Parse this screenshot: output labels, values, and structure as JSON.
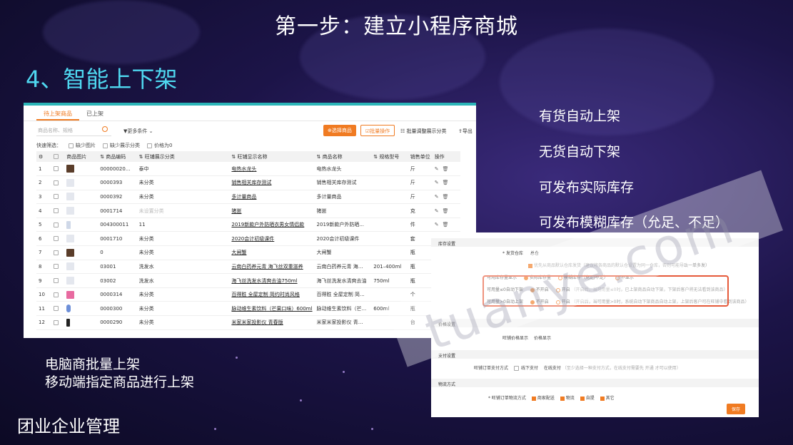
{
  "slide": {
    "title": "第一步：建立小程序商城",
    "section": "4、智能上下架",
    "features": [
      "有货自动上架",
      "无货自动下架",
      "可发布实际库存",
      "可发布模糊库存（允足、不足）"
    ],
    "notes": [
      "电脑商批量上架",
      "移动端指定商品进行上架"
    ],
    "company": "团业企业管理",
    "watermark": "tuanye.com"
  },
  "product_panel": {
    "tabs": [
      "待上架商品",
      "已上架"
    ],
    "search_placeholder": "商品名称、规格",
    "more_filter": "更多条件",
    "select_btn": "选择商品",
    "batch_btn": "批量操作",
    "batch_category": "批量调整展示分类",
    "export": "导出",
    "quick_filter_label": "快速筛选：",
    "quick_filters": [
      "缺少图片",
      "缺少展示分类",
      "价格为0"
    ],
    "columns": [
      "商品图片",
      "商品编码",
      "旺铺展示分类",
      "旺铺显示名称",
      "商品名称",
      "规格型号",
      "销售单位",
      "操作"
    ],
    "rows": [
      {
        "no": "1",
        "code": "00000020...",
        "cat": "泰中",
        "show": "电热水龙头",
        "name": "电热水龙头",
        "spec": "",
        "unit": "斤"
      },
      {
        "no": "2",
        "code": "0000393",
        "cat": "未分类",
        "show": "销售相关库存测试",
        "name": "销售相关库存测试",
        "spec": "",
        "unit": "斤"
      },
      {
        "no": "3",
        "code": "0000392",
        "cat": "未分类",
        "show": "多计量商品",
        "name": "多计量商品",
        "spec": "",
        "unit": "斤"
      },
      {
        "no": "4",
        "code": "0001714",
        "cat": "未设置分类",
        "show": "猪崽",
        "name": "猪崽",
        "spec": "",
        "unit": "克"
      },
      {
        "no": "5",
        "code": "004300011",
        "cat": "11",
        "show": "2019新款户外防晒衣男女情侣款",
        "name": "2019新款户外防晒...",
        "spec": "",
        "unit": "件"
      },
      {
        "no": "6",
        "code": "0001710",
        "cat": "未分类",
        "show": "2020会计初级课件",
        "name": "2020会计初级课件",
        "spec": "",
        "unit": "套"
      },
      {
        "no": "7",
        "code": "0",
        "cat": "未分类",
        "show": "大闸蟹",
        "name": "大闸蟹",
        "spec": "",
        "unit": "瓶"
      },
      {
        "no": "8",
        "code": "03001",
        "cat": "洗发水",
        "show": "云南白药养元青 海飞丝双重滋养",
        "name": "云南白药养元青 海...",
        "spec": "201–400ml",
        "unit": "瓶"
      },
      {
        "no": "9",
        "code": "03002",
        "cat": "洗发水",
        "show": "海飞丝洗发水清爽去油750ml",
        "name": "海飞丝洗发水清爽去油",
        "spec": "750ml",
        "unit": "瓶"
      },
      {
        "no": "10",
        "code": "0000314",
        "cat": "未分类",
        "show": "百得胜 全屋定制 简约时尚风格",
        "name": "百得胜 全屋定制 简...",
        "spec": "",
        "unit": "个"
      },
      {
        "no": "11",
        "code": "0000300",
        "cat": "未分类",
        "show": "脉动维生素饮料（芒果口味）600ml",
        "name": "脉动维生素饮料（芒...",
        "spec": "600ml",
        "unit": "瓶"
      },
      {
        "no": "12",
        "code": "0000290",
        "cat": "未分类",
        "show": "米家米家投影仪 青春版",
        "name": "米家米家投影仪 青...",
        "spec": "",
        "unit": "台"
      }
    ]
  },
  "settings_panel": {
    "sec_stock": "库存设置",
    "ship_warehouse": "* 发货仓库",
    "ship_warehouse_val": "总仓",
    "priority": "优先从商品默认仓库发货（建议将各商品的默认仓设置为同一仓库，否则可能导致一单多发）",
    "stock_qty_label": "可用库存量显示",
    "stock_opt1": "实际库存量",
    "stock_opt2": "模糊库存（充足/不足）",
    "stock_opt3": "不显示",
    "auto_down_label": "可用量≤0自动下架",
    "auto_down_off": "不开启",
    "auto_down_on": "开启",
    "auto_down_desc": "（开启后，当可用量≤0时，已上架商品自动下架，下架后客户将无法看到该商品）",
    "auto_up_label": "可用量>0自动上架",
    "auto_up_off": "不开启",
    "auto_up_on": "开启",
    "auto_up_desc": "（开启后，当可用量>0时，系统自动下架商品自动上架，上架后客户可在旺铺中看到该商品）",
    "sec_price": "价格设置",
    "price_label": "旺铺价格显示",
    "price_val": "价格显示",
    "sec_pay": "支付设置",
    "pay_label": "旺铺订单支付方式",
    "pay_offline": "线下支付",
    "pay_online": "在线支付",
    "pay_desc": "（至少选择一种支付方式，在线支付需要先 开通 才可以使用）",
    "sec_logistics": "物流方式",
    "logistics_label": "* 旺铺订单物流方式",
    "logistics_opts": [
      "商家配送",
      "物流",
      "自提",
      "其它"
    ],
    "save": "保存"
  },
  "colors": {
    "accent_orange": "#f07b22",
    "title_cyan": "#4fd8f0",
    "highlight_red": "#e65a3a",
    "tab_teal": "#2bb5b8"
  }
}
